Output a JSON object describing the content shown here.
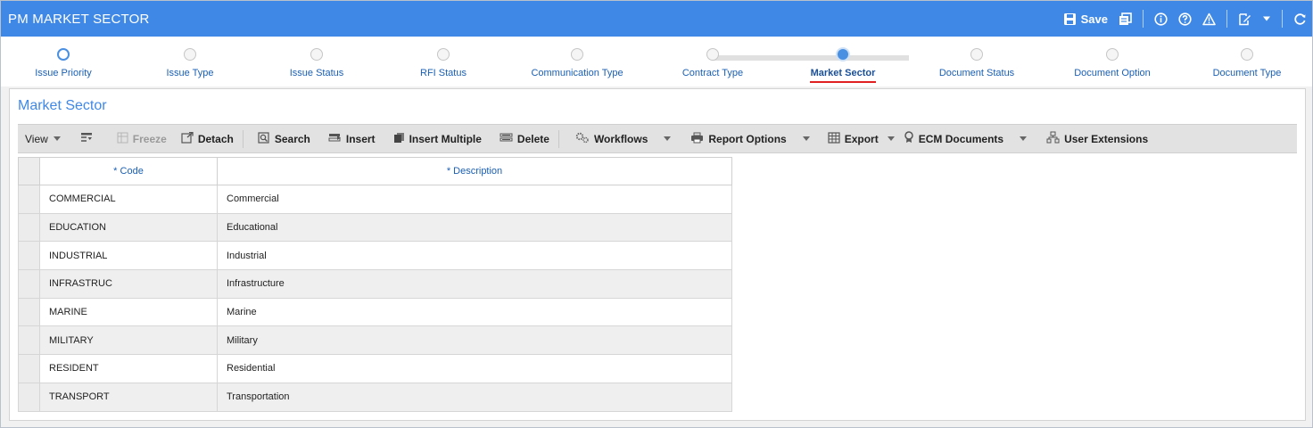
{
  "window": {
    "title": "PM MARKET SECTOR",
    "save_label": "Save",
    "accent_color": "#3f88e6",
    "icons": [
      "save-icon",
      "copy-window-icon",
      "info-icon",
      "help-icon",
      "warning-icon",
      "edit-note-icon",
      "chevron-down-icon",
      "refresh-icon"
    ]
  },
  "wizard": {
    "active_index": 6,
    "steps": [
      {
        "label": "Issue Priority"
      },
      {
        "label": "Issue Type"
      },
      {
        "label": "Issue Status"
      },
      {
        "label": "RFI Status"
      },
      {
        "label": "Communication Type"
      },
      {
        "label": "Contract Type"
      },
      {
        "label": "Market Sector"
      },
      {
        "label": "Document Status"
      },
      {
        "label": "Document Option"
      },
      {
        "label": "Document Type"
      }
    ]
  },
  "panel": {
    "title": "Market Sector"
  },
  "toolbar": {
    "view_label": "View",
    "freeze_label": "Freeze",
    "detach_label": "Detach",
    "search_label": "Search",
    "insert_label": "Insert",
    "insert_multiple_label": "Insert Multiple",
    "delete_label": "Delete",
    "workflows_label": "Workflows",
    "report_options_label": "Report Options",
    "export_label": "Export",
    "ecm_documents_label": "ECM Documents",
    "user_extensions_label": "User Extensions"
  },
  "grid": {
    "columns": {
      "code": "* Code",
      "description": "* Description"
    },
    "rows": [
      {
        "code": "COMMERCIAL",
        "description": "Commercial"
      },
      {
        "code": "EDUCATION",
        "description": "Educational"
      },
      {
        "code": "INDUSTRIAL",
        "description": "Industrial"
      },
      {
        "code": "INFRASTRUC",
        "description": "Infrastructure"
      },
      {
        "code": "MARINE",
        "description": "Marine"
      },
      {
        "code": "MILITARY",
        "description": "Military"
      },
      {
        "code": "RESIDENT",
        "description": "Residential"
      },
      {
        "code": "TRANSPORT",
        "description": "Transportation"
      }
    ]
  }
}
